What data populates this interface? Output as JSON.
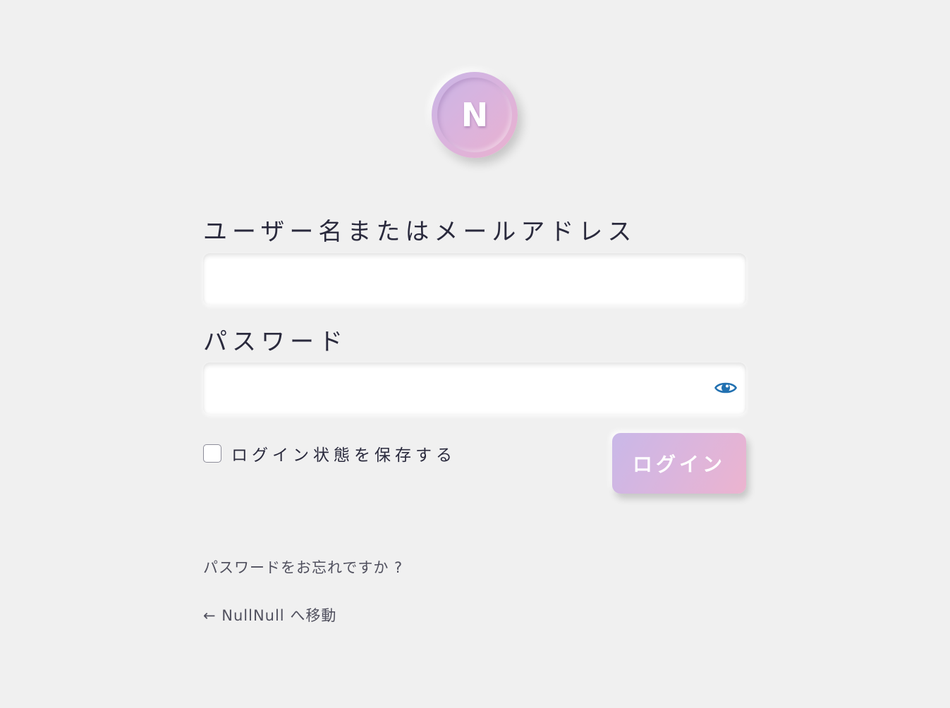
{
  "logo": {
    "letter": "N"
  },
  "form": {
    "username_label": "ユーザー名またはメールアドレス",
    "username_value": "",
    "password_label": "パスワード",
    "password_value": "",
    "show_password_icon": "eye-icon",
    "remember_label": "ログイン状態を保存する",
    "remember_checked": false,
    "submit_label": "ログイン"
  },
  "links": {
    "lost_password": "パスワードをお忘れですか ?",
    "back_to_site": "← NullNull へ移動"
  },
  "colors": {
    "background": "#f0f0f0",
    "accent_start": "#c9b8e8",
    "accent_end": "#ecb4cf",
    "eye_icon": "#2271b1",
    "text": "#2a2a3d"
  }
}
